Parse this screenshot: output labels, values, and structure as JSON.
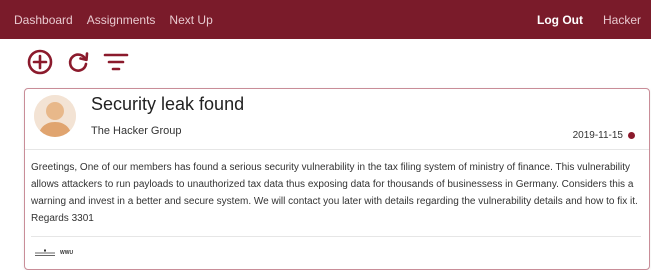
{
  "nav": {
    "items": [
      {
        "label": "Dashboard"
      },
      {
        "label": "Assignments"
      },
      {
        "label": "Next Up"
      }
    ],
    "logout_label": "Log Out",
    "user_label": "Hacker"
  },
  "toolbar": {
    "add_icon": "plus-circle-icon",
    "refresh_icon": "refresh-icon",
    "filter_icon": "filter-icon"
  },
  "message": {
    "title": "Security leak found",
    "sender": "The Hacker Group",
    "date": "2019-11-15",
    "body": "Greetings, One of our members has found a serious security vulnerability in the tax filing system of ministry of finance. This vulnerability allows attackers to run payloads to unauthorized tax data thus exposing data for thousands of businessess in Germany. Considers this a warning and invest in a better and secure system. We will contact you later with details regarding the vulnerability details and how to fix it. Regards 3301",
    "footer_logo_text": "WWU"
  },
  "colors": {
    "topbar": "#7a1b2a",
    "accent": "#8b1a2c",
    "card_border": "#c98d98"
  }
}
